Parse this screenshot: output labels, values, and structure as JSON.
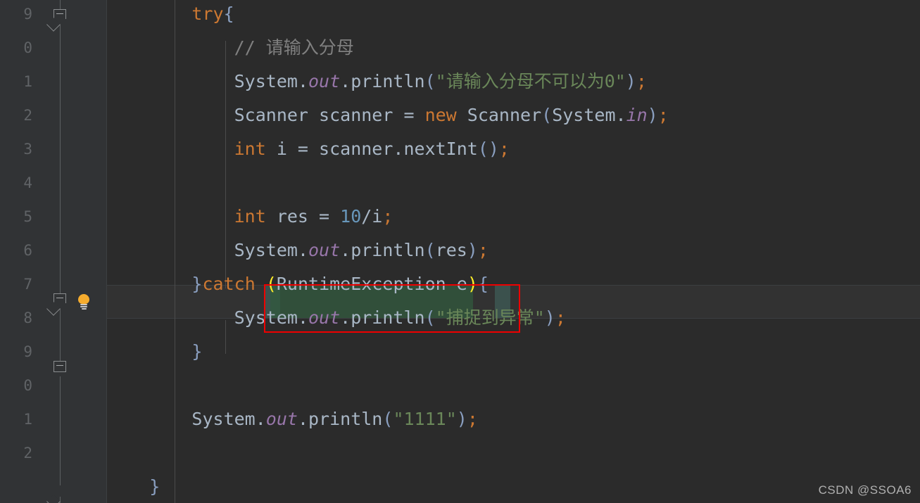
{
  "editor": {
    "theme_name": "darcula",
    "background": "#2b2b2b",
    "gutter_background": "#313335",
    "current_line_background": "#323232",
    "annotation_color": "#ee0000",
    "bracket_match_color": "#ffef28",
    "selection_background": "#32593d"
  },
  "gutter": {
    "line_numbers": [
      "9",
      "0",
      "1",
      "2",
      "3",
      "4",
      "5",
      "6",
      "7",
      "8",
      "9",
      "0",
      "1",
      "2"
    ],
    "bulb_icon": "lightbulb-icon",
    "fold_icons": [
      "fold-minus-icon",
      "fold-minus-icon",
      "fold-flat-minus-icon",
      "fold-arrow-icon"
    ]
  },
  "code_lines": [
    {
      "index": 0,
      "tokens": [
        {
          "t": "        ",
          "c": "plain"
        },
        {
          "t": "try",
          "c": "kw"
        },
        {
          "t": "{",
          "c": "brc2"
        }
      ]
    },
    {
      "index": 1,
      "tokens": [
        {
          "t": "            ",
          "c": "plain"
        },
        {
          "t": "// 请输入分母",
          "c": "cmt"
        }
      ]
    },
    {
      "index": 2,
      "tokens": [
        {
          "t": "            ",
          "c": "plain"
        },
        {
          "t": "System",
          "c": "plain"
        },
        {
          "t": ".",
          "c": "plain"
        },
        {
          "t": "out",
          "c": "fld"
        },
        {
          "t": ".println",
          "c": "plain"
        },
        {
          "t": "(",
          "c": "brc2"
        },
        {
          "t": "\"请输入分母不可以为0\"",
          "c": "str"
        },
        {
          "t": ")",
          "c": "brc2"
        },
        {
          "t": ";",
          "c": "semi"
        }
      ]
    },
    {
      "index": 3,
      "tokens": [
        {
          "t": "            ",
          "c": "plain"
        },
        {
          "t": "Scanner scanner = ",
          "c": "plain"
        },
        {
          "t": "new",
          "c": "kw"
        },
        {
          "t": " Scanner",
          "c": "plain"
        },
        {
          "t": "(",
          "c": "brc2"
        },
        {
          "t": "System.",
          "c": "plain"
        },
        {
          "t": "in",
          "c": "fld"
        },
        {
          "t": ")",
          "c": "brc2"
        },
        {
          "t": ";",
          "c": "semi"
        }
      ]
    },
    {
      "index": 4,
      "tokens": [
        {
          "t": "            ",
          "c": "plain"
        },
        {
          "t": "int",
          "c": "kw"
        },
        {
          "t": " i = scanner.nextInt",
          "c": "plain"
        },
        {
          "t": "()",
          "c": "brc2"
        },
        {
          "t": ";",
          "c": "semi"
        }
      ]
    },
    {
      "index": 5,
      "tokens": []
    },
    {
      "index": 6,
      "tokens": [
        {
          "t": "            ",
          "c": "plain"
        },
        {
          "t": "int",
          "c": "kw"
        },
        {
          "t": " res = ",
          "c": "plain"
        },
        {
          "t": "10",
          "c": "num"
        },
        {
          "t": "/i",
          "c": "plain"
        },
        {
          "t": ";",
          "c": "semi"
        }
      ]
    },
    {
      "index": 7,
      "tokens": [
        {
          "t": "            ",
          "c": "plain"
        },
        {
          "t": "System",
          "c": "plain"
        },
        {
          "t": ".",
          "c": "plain"
        },
        {
          "t": "out",
          "c": "fld"
        },
        {
          "t": ".println",
          "c": "plain"
        },
        {
          "t": "(",
          "c": "brc2"
        },
        {
          "t": "res",
          "c": "plain"
        },
        {
          "t": ")",
          "c": "brc2"
        },
        {
          "t": ";",
          "c": "semi"
        }
      ]
    },
    {
      "index": 8,
      "tokens": [
        {
          "t": "        ",
          "c": "plain"
        },
        {
          "t": "}",
          "c": "brc2"
        },
        {
          "t": "catch",
          "c": "kw"
        },
        {
          "t": " ",
          "c": "plain"
        },
        {
          "t": "(",
          "c": "match"
        },
        {
          "t": "RuntimeException e",
          "c": "plain"
        },
        {
          "t": ")",
          "c": "match"
        },
        {
          "t": "{",
          "c": "brc2"
        }
      ]
    },
    {
      "index": 9,
      "tokens": [
        {
          "t": "            ",
          "c": "plain"
        },
        {
          "t": "System",
          "c": "plain"
        },
        {
          "t": ".",
          "c": "plain"
        },
        {
          "t": "out",
          "c": "fld"
        },
        {
          "t": ".println",
          "c": "plain"
        },
        {
          "t": "(",
          "c": "brc2"
        },
        {
          "t": "\"捕捉到异常\"",
          "c": "str"
        },
        {
          "t": ")",
          "c": "brc2"
        },
        {
          "t": ";",
          "c": "semi"
        }
      ]
    },
    {
      "index": 10,
      "tokens": [
        {
          "t": "        ",
          "c": "plain"
        },
        {
          "t": "}",
          "c": "brc2"
        }
      ]
    },
    {
      "index": 11,
      "tokens": []
    },
    {
      "index": 12,
      "tokens": [
        {
          "t": "        ",
          "c": "plain"
        },
        {
          "t": "System",
          "c": "plain"
        },
        {
          "t": ".",
          "c": "plain"
        },
        {
          "t": "out",
          "c": "fld"
        },
        {
          "t": ".println",
          "c": "plain"
        },
        {
          "t": "(",
          "c": "brc2"
        },
        {
          "t": "\"1111\"",
          "c": "str"
        },
        {
          "t": ")",
          "c": "brc2"
        },
        {
          "t": ";",
          "c": "semi"
        }
      ]
    },
    {
      "index": 13,
      "tokens": []
    },
    {
      "index": 14,
      "tokens": [
        {
          "t": "    ",
          "c": "plain"
        },
        {
          "t": "}",
          "c": "brc2"
        }
      ]
    }
  ],
  "highlight": {
    "selected_text": "RuntimeException",
    "matched_brackets": [
      "(",
      ")"
    ],
    "annotation_label": "red-rectangle-around-catch-parameter"
  },
  "watermark": {
    "text": "CSDN @SSOA6"
  }
}
